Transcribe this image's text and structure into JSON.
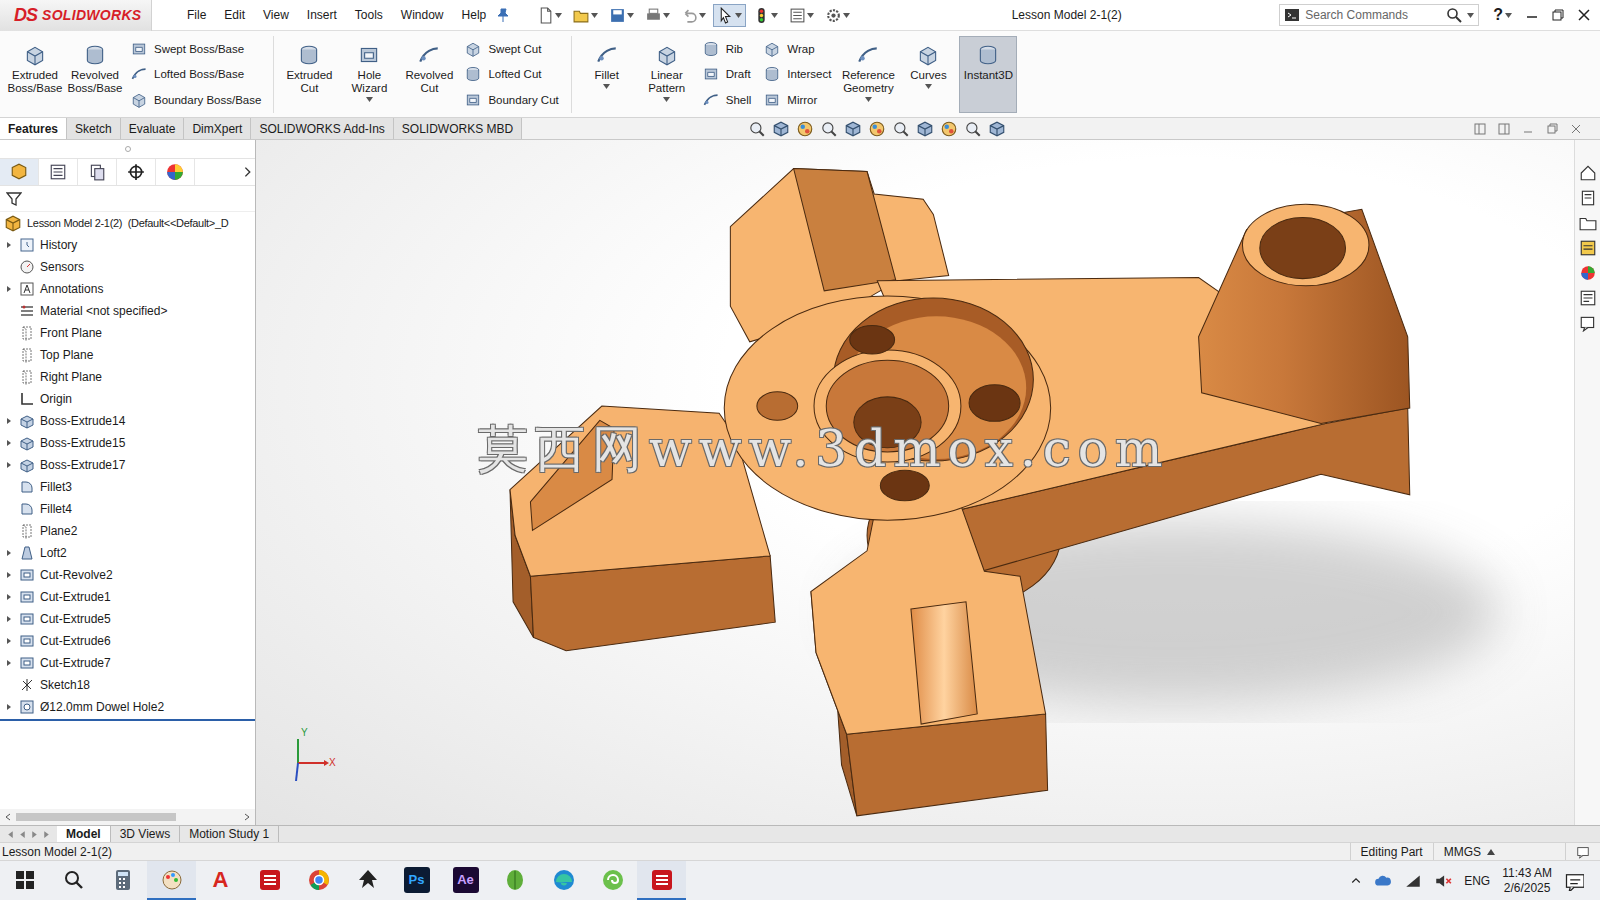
{
  "window": {
    "title": "Lesson Model 2-1(2)",
    "logo": {
      "mark": "DS",
      "name": "SOLIDWORKS"
    }
  },
  "menu": [
    "File",
    "Edit",
    "View",
    "Insert",
    "Tools",
    "Window",
    "Help"
  ],
  "quick_access": [
    {
      "kind": "new",
      "active": false
    },
    {
      "kind": "open",
      "active": false
    },
    {
      "kind": "save",
      "active": false
    },
    {
      "kind": "print",
      "active": false
    },
    {
      "kind": "undo",
      "active": false
    },
    {
      "kind": "select",
      "active": true
    },
    {
      "kind": "light",
      "active": false
    },
    {
      "kind": "props",
      "active": false
    },
    {
      "kind": "gear",
      "active": false
    }
  ],
  "search": {
    "placeholder": "Search Commands"
  },
  "help": "?",
  "ribbon": [
    {
      "columns": [
        {
          "kind": "large",
          "label": "Extruded Boss/Base",
          "dropdown": false,
          "selected": false
        },
        {
          "kind": "large",
          "label": "Revolved Boss/Base",
          "dropdown": false,
          "selected": false
        },
        {
          "kind": "stack",
          "items": [
            "Swept Boss/Base",
            "Lofted Boss/Base",
            "Boundary Boss/Base"
          ]
        }
      ]
    },
    {
      "columns": [
        {
          "kind": "large",
          "label": "Extruded Cut",
          "dropdown": false,
          "selected": false
        },
        {
          "kind": "large",
          "label": "Hole Wizard",
          "dropdown": true,
          "selected": false
        },
        {
          "kind": "large",
          "label": "Revolved Cut",
          "dropdown": false,
          "selected": false
        },
        {
          "kind": "stack",
          "items": [
            "Swept Cut",
            "Lofted Cut",
            "Boundary Cut"
          ]
        }
      ]
    },
    {
      "columns": [
        {
          "kind": "large",
          "label": "Fillet",
          "dropdown": true,
          "selected": false
        },
        {
          "kind": "large",
          "label": "Linear Pattern",
          "dropdown": true,
          "selected": false
        },
        {
          "kind": "stack",
          "items": [
            "Rib",
            "Draft",
            "Shell"
          ]
        },
        {
          "kind": "stack",
          "items": [
            "Wrap",
            "Intersect",
            "Mirror"
          ]
        },
        {
          "kind": "large",
          "label": "Reference Geometry",
          "dropdown": true,
          "selected": false
        },
        {
          "kind": "large",
          "label": "Curves",
          "dropdown": true,
          "selected": false
        },
        {
          "kind": "large",
          "label": "Instant3D",
          "dropdown": false,
          "selected": true
        }
      ]
    }
  ],
  "command_tabs": [
    {
      "label": "Features",
      "selected": true
    },
    {
      "label": "Sketch",
      "selected": false
    },
    {
      "label": "Evaluate",
      "selected": false
    },
    {
      "label": "DimXpert",
      "selected": false
    },
    {
      "label": "SOLIDWORKS Add-Ins",
      "selected": false
    },
    {
      "label": "SOLIDWORKS MBD",
      "selected": false
    }
  ],
  "feature_tree": {
    "root": "Lesson Model 2-1(2)  (Default<<Default>_D",
    "items": [
      {
        "label": "History",
        "kind": "history",
        "expandable": true
      },
      {
        "label": "Sensors",
        "kind": "sensors",
        "expandable": false
      },
      {
        "label": "Annotations",
        "kind": "annotations",
        "expandable": true
      },
      {
        "label": "Material <not specified>",
        "kind": "material",
        "expandable": false
      },
      {
        "label": "Front Plane",
        "kind": "plane",
        "expandable": false
      },
      {
        "label": "Top Plane",
        "kind": "plane",
        "expandable": false
      },
      {
        "label": "Right Plane",
        "kind": "plane",
        "expandable": false
      },
      {
        "label": "Origin",
        "kind": "origin",
        "expandable": false
      },
      {
        "label": "Boss-Extrude14",
        "kind": "boss",
        "expandable": true
      },
      {
        "label": "Boss-Extrude15",
        "kind": "boss",
        "expandable": true
      },
      {
        "label": "Boss-Extrude17",
        "kind": "boss",
        "expandable": true
      },
      {
        "label": "Fillet3",
        "kind": "fillet",
        "expandable": false
      },
      {
        "label": "Fillet4",
        "kind": "fillet",
        "expandable": false
      },
      {
        "label": "Plane2",
        "kind": "plane",
        "expandable": false
      },
      {
        "label": "Loft2",
        "kind": "loft",
        "expandable": true
      },
      {
        "label": "Cut-Revolve2",
        "kind": "cut",
        "expandable": true
      },
      {
        "label": "Cut-Extrude1",
        "kind": "cut",
        "expandable": true
      },
      {
        "label": "Cut-Extrude5",
        "kind": "cut",
        "expandable": true
      },
      {
        "label": "Cut-Extrude6",
        "kind": "cut",
        "expandable": true
      },
      {
        "label": "Cut-Extrude7",
        "kind": "cut",
        "expandable": true
      },
      {
        "label": "Sketch18",
        "kind": "sketch",
        "expandable": false
      },
      {
        "label": "Ø12.0mm Dowel Hole2",
        "kind": "hole",
        "expandable": true
      }
    ]
  },
  "viewport": {
    "watermark": "莫西网www.3dmox.com",
    "triad": {
      "x": "X",
      "y": "Y"
    }
  },
  "bottom_tabs": [
    {
      "label": "Model",
      "selected": true
    },
    {
      "label": "3D Views",
      "selected": false
    },
    {
      "label": "Motion Study 1",
      "selected": false
    }
  ],
  "status_bar": {
    "document": "Lesson Model 2-1(2)",
    "mode": "Editing Part",
    "units": "MMGS"
  },
  "taskbar": {
    "apps": [
      {
        "kind": "start",
        "running": false
      },
      {
        "kind": "search",
        "running": false
      },
      {
        "kind": "calculator",
        "running": false
      },
      {
        "kind": "paint",
        "running": true
      },
      {
        "kind": "acrobat",
        "label": "A",
        "running": false
      },
      {
        "kind": "solidworks",
        "running": false
      },
      {
        "kind": "chrome",
        "running": false
      },
      {
        "kind": "inkscape",
        "running": false
      },
      {
        "kind": "photoshop",
        "label": "Ps",
        "running": false
      },
      {
        "kind": "aftereffects",
        "label": "Ae",
        "running": false
      },
      {
        "kind": "leaf",
        "running": false
      },
      {
        "kind": "edge",
        "running": false
      },
      {
        "kind": "swirl",
        "running": false
      },
      {
        "kind": "solidworks",
        "running": true
      }
    ],
    "language": "ENG",
    "time": "11:43 AM",
    "date": "2/6/2025"
  }
}
